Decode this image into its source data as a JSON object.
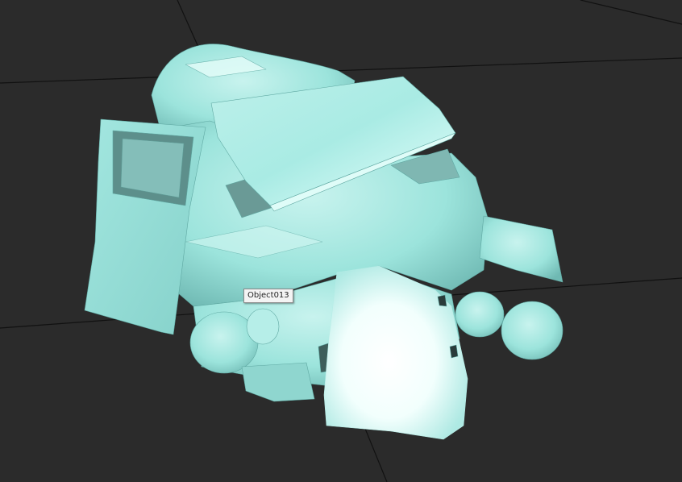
{
  "viewport": {
    "background_color": "#2b2b2b",
    "grid_color": "#0f0f0f",
    "object_color": "#9ce4dc",
    "object_highlight": "#ffffff",
    "object_shadow": "#5fa8a2"
  },
  "hover_tooltip": {
    "label": "Object013"
  }
}
